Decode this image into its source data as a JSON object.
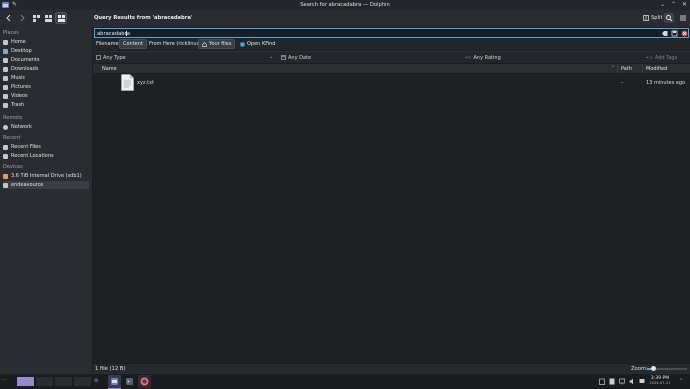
{
  "window": {
    "title": "Search for abracadabra — Dolphin"
  },
  "toolbar": {
    "query_title": "Query Results from 'abracadabra'",
    "split_label": "Split"
  },
  "sidebar": {
    "places_heading": "Places",
    "places": [
      "Home",
      "Desktop",
      "Documents",
      "Downloads",
      "Music",
      "Pictures",
      "Videos",
      "Trash"
    ],
    "remote_heading": "Remote",
    "remote": [
      "Network"
    ],
    "recent_heading": "Recent",
    "recent": [
      "Recent Files",
      "Recent Locations"
    ],
    "devices_heading": "Devices",
    "devices": [
      "3.6 TiB Internal Drive (sdb1)",
      "endeavouros"
    ]
  },
  "search": {
    "value": "abracadabra"
  },
  "filters": {
    "filename": "Filename",
    "content": "Content",
    "from_here": "From Here (ricklinux)",
    "your_files": "Your files",
    "open_kfind": "Open KFind"
  },
  "facets": {
    "type": "Any Type",
    "date": "Any Date",
    "rating": "Any Rating",
    "tags": "Add Tags"
  },
  "columns": {
    "name": "Name",
    "path": "Path",
    "modified": "Modified"
  },
  "files": [
    {
      "name": "xyz.txt",
      "path": "–",
      "modified": "13 minutes ago"
    }
  ],
  "status": {
    "count": "1 file (12 B)",
    "zoom_label": "Zoom:",
    "zoom_level": 0.15
  },
  "taskbar": {
    "time": "3:39 PM",
    "date": "2024-07-21"
  },
  "colors": {
    "accent": "#3daee9",
    "selection": "#3a3e44",
    "pager_active": "#9a89cf"
  }
}
